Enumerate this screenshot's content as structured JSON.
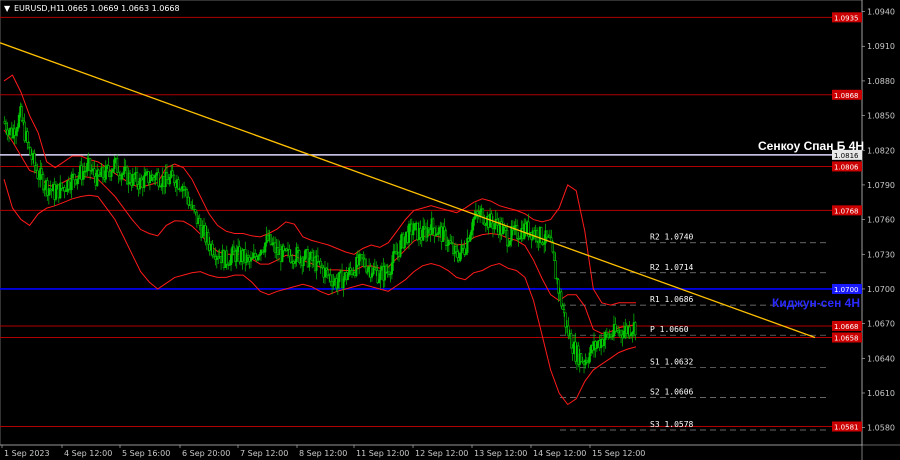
{
  "header": {
    "symbol": "EURUSD,H1",
    "ohlc": "1.0665 1.0669 1.0663 1.0668"
  },
  "colors": {
    "background": "#000000",
    "candle": "#00c800",
    "bollinger": "#ff1a1a",
    "trendline": "#ffc000",
    "level_line": "#b00000",
    "senkou_line": "#e0d8ff",
    "kijun_line": "#0000ff",
    "price_tag": "#cc0000",
    "grid_text": "#c8c8c8"
  },
  "labels": {
    "senkou": "Сенкоу Спан Б 4Н",
    "kijun": "Киджун-сен 4Н"
  },
  "chart_data": {
    "type": "candlestick",
    "symbol": "EURUSD",
    "timeframe": "H1",
    "ylim": [
      1.0565,
      1.095
    ],
    "yticks": [
      "1.0940",
      "1.0910",
      "1.0880",
      "1.0850",
      "1.0820",
      "1.0790",
      "1.0760",
      "1.0730",
      "1.0700",
      "1.0670",
      "1.0640",
      "1.0610",
      "1.0580"
    ],
    "xticks": [
      "1 Sep 2023",
      "4 Sep 12:00",
      "5 Sep 16:00",
      "6 Sep 20:00",
      "7 Sep 12:00",
      "8 Sep 12:00",
      "11 Sep 12:00",
      "12 Sep 12:00",
      "13 Sep 12:00",
      "14 Sep 12:00",
      "15 Sep 12:00"
    ],
    "levels": [
      {
        "kind": "resistance",
        "value": 1.0935,
        "tag": "1.0935"
      },
      {
        "kind": "resistance",
        "value": 1.0868,
        "tag": "1.0868"
      },
      {
        "kind": "senkou",
        "value": 1.0816,
        "tag": "1.0816"
      },
      {
        "kind": "resistance",
        "value": 1.0806,
        "tag": "1.0806"
      },
      {
        "kind": "resistance",
        "value": 1.0768,
        "tag": "1.0768"
      },
      {
        "kind": "kijun",
        "value": 1.07,
        "tag": "1.0700"
      },
      {
        "kind": "resistance",
        "value": 1.0668,
        "tag": "1.0668"
      },
      {
        "kind": "resistance",
        "value": 1.0658,
        "tag": "1.0658"
      },
      {
        "kind": "support",
        "value": 1.0581,
        "tag": "1.0581"
      }
    ],
    "pivots": [
      {
        "label": "R2",
        "value": "1.0740"
      },
      {
        "label": "R2",
        "value": "1.0714"
      },
      {
        "label": "R1",
        "value": "1.0686"
      },
      {
        "label": "P",
        "value": "1.0660"
      },
      {
        "label": "S1",
        "value": "1.0632"
      },
      {
        "label": "S2",
        "value": "1.0606"
      },
      {
        "label": "S3",
        "value": "1.0578"
      }
    ],
    "trendline": {
      "start": 1.0913,
      "end": 1.0658
    },
    "price_path": [
      1.0845,
      1.0835,
      1.085,
      1.082,
      1.08,
      1.079,
      1.0783,
      1.0788,
      1.0795,
      1.08,
      1.0805,
      1.0795,
      1.08,
      1.0808,
      1.08,
      1.0795,
      1.0792,
      1.0796,
      1.0798,
      1.0793,
      1.0796,
      1.079,
      1.077,
      1.0755,
      1.074,
      1.0732,
      1.0725,
      1.073,
      1.0728,
      1.0722,
      1.0735,
      1.0742,
      1.0732,
      1.0728,
      1.073,
      1.0728,
      1.0725,
      1.072,
      1.0712,
      1.0706,
      1.071,
      1.0718,
      1.0724,
      1.0718,
      1.0712,
      1.0716,
      1.073,
      1.0745,
      1.0752,
      1.0746,
      1.0755,
      1.075,
      1.0742,
      1.0728,
      1.0735,
      1.076,
      1.0765,
      1.0758,
      1.0755,
      1.0745,
      1.0748,
      1.0752,
      1.075,
      1.0745,
      1.074,
      1.07,
      1.0665,
      1.0645,
      1.0638,
      1.0648,
      1.0656,
      1.066,
      1.0663,
      1.0665,
      1.0668
    ],
    "bb_upper": [
      1.088,
      1.0885,
      1.087,
      1.085,
      1.0835,
      1.081,
      1.0805,
      1.081,
      1.0815,
      1.0815,
      1.0812,
      1.081,
      1.0805,
      1.08,
      1.0795,
      1.079,
      1.0788,
      1.079,
      1.0792,
      1.0805,
      1.0808,
      1.0805,
      1.0795,
      1.078,
      1.0765,
      1.0755,
      1.075,
      1.0748,
      1.0748,
      1.0746,
      1.0745,
      1.0748,
      1.0752,
      1.0758,
      1.0756,
      1.0745,
      1.0742,
      1.074,
      1.0738,
      1.0735,
      1.0732,
      1.073,
      1.0735,
      1.0738,
      1.0736,
      1.074,
      1.075,
      1.076,
      1.0768,
      1.077,
      1.0772,
      1.077,
      1.0768,
      1.0766,
      1.077,
      1.0775,
      1.0778,
      1.0776,
      1.0772,
      1.077,
      1.0768,
      1.0765,
      1.076,
      1.0758,
      1.076,
      1.077,
      1.079,
      1.0785,
      1.075,
      1.07,
      1.0688,
      1.0686,
      1.0688,
      1.0688,
      1.0688
    ],
    "bb_lower": [
      1.0795,
      1.077,
      1.076,
      1.0755,
      1.0765,
      1.077,
      1.0772,
      1.0775,
      1.0778,
      1.078,
      1.0781,
      1.078,
      1.077,
      1.076,
      1.0745,
      1.073,
      1.0715,
      1.0706,
      1.07,
      1.0705,
      1.071,
      1.0712,
      1.0714,
      1.0715,
      1.0712,
      1.071,
      1.071,
      1.0712,
      1.0712,
      1.0706,
      1.0698,
      1.0695,
      1.0698,
      1.07,
      1.0702,
      1.0704,
      1.0702,
      1.0698,
      1.0695,
      1.0698,
      1.07,
      1.0702,
      1.0704,
      1.0702,
      1.07,
      1.0698,
      1.0703,
      1.0708,
      1.0715,
      1.072,
      1.0722,
      1.072,
      1.0716,
      1.071,
      1.0708,
      1.0714,
      1.0716,
      1.072,
      1.0722,
      1.0718,
      1.0716,
      1.071,
      1.069,
      1.066,
      1.063,
      1.061,
      1.06,
      1.0605,
      1.062,
      1.063,
      1.0635,
      1.064,
      1.0645,
      1.0648,
      1.065
    ]
  }
}
